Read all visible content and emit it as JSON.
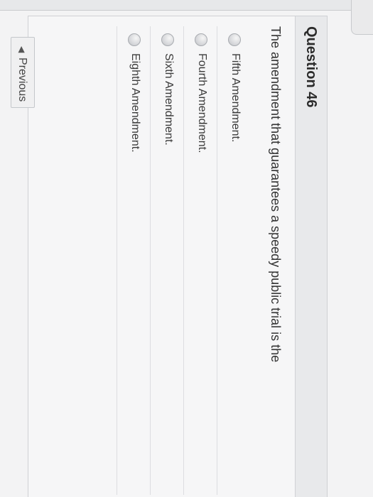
{
  "question": {
    "number": "Question 46",
    "prompt": "The amendment that guarantees a speedy public trial is the",
    "answers": [
      {
        "label": "Fifth Amendment."
      },
      {
        "label": "Fourth Amendment."
      },
      {
        "label": "Sixth Amendment."
      },
      {
        "label": "Eighth Amendment."
      }
    ]
  },
  "navigation": {
    "previous_label": "Previous",
    "previous_icon": "triangle-left-icon"
  },
  "colors": {
    "page_bg": "#f3f3f4",
    "card_border": "#cfd1d4",
    "text": "#333333"
  }
}
